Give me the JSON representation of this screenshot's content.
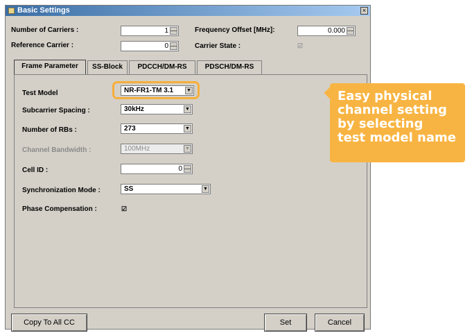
{
  "dialog": {
    "title": "Basic Settings",
    "close_glyph": "×"
  },
  "fields": {
    "number_of_carriers": {
      "label": "Number of Carriers :",
      "value": "1"
    },
    "frequency_offset": {
      "label": "Frequency Offset [MHz]:",
      "value": "0.000"
    },
    "reference_carrier": {
      "label": "Reference Carrier :",
      "value": "0"
    },
    "carrier_state": {
      "label": "Carrier State :",
      "checked_glyph": "☑"
    }
  },
  "tabs": [
    {
      "label": "Frame Parameter",
      "active": true
    },
    {
      "label": "SS-Block"
    },
    {
      "label": "PDCCH/DM-RS"
    },
    {
      "label": "PDSCH/DM-RS"
    }
  ],
  "frame": {
    "test_model": {
      "label": "Test Model",
      "value": "NR-FR1-TM 3.1"
    },
    "subcarrier_spacing": {
      "label": "Subcarrier Spacing :",
      "value": "30kHz"
    },
    "number_of_rbs": {
      "label": "Number of RBs :",
      "value": "273"
    },
    "channel_bandwidth": {
      "label": "Channel Bandwidth :",
      "value": "100MHz"
    },
    "cell_id": {
      "label": "Cell ID :",
      "value": "0"
    },
    "synchronization_mode": {
      "label": "Synchronization Mode :",
      "value": "SS"
    },
    "phase_compensation": {
      "label": "Phase Compensation :",
      "checked_glyph": "☑"
    }
  },
  "buttons": {
    "copy_to_all_cc": "Copy To All CC",
    "set": "Set",
    "cancel": "Cancel"
  },
  "callout": {
    "lines": [
      "Easy physical",
      "channel setting",
      "by selecting",
      "test model name"
    ]
  },
  "colors": {
    "accent": "#f8b442",
    "dialog_bg": "#d4d0c8",
    "title_start": "#3a6ea5"
  }
}
